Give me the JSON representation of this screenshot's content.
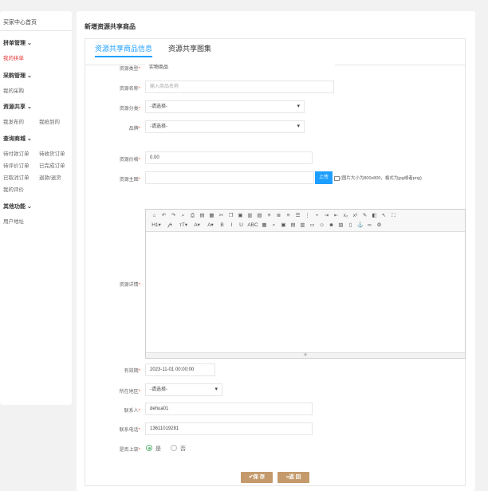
{
  "sidebar": {
    "title": "买家中心首页",
    "groups": [
      {
        "label": "拼单管理",
        "chev": "⌄",
        "items": [
          {
            "label": "我的拼单",
            "active": true
          }
        ]
      },
      {
        "label": "采购管理",
        "chev": "⌄",
        "items": [
          {
            "label": "我的采购"
          }
        ]
      },
      {
        "label": "资源共享",
        "chev": "⌄",
        "items": [
          {
            "label": "我发布的"
          },
          {
            "label": "我抢到的"
          }
        ]
      },
      {
        "label": "查询商城",
        "chev": "⌄",
        "items": [
          {
            "label": "待付款订单"
          },
          {
            "label": "待收货订单"
          },
          {
            "label": "待评价订单"
          },
          {
            "label": "已完成订单"
          },
          {
            "label": "已取消订单"
          },
          {
            "label": "退款/退货"
          },
          {
            "label": "我的评价"
          }
        ]
      },
      {
        "label": "其他功能",
        "chev": "⌄",
        "items": [
          {
            "label": "用户地址"
          }
        ]
      }
    ]
  },
  "main": {
    "title": "新增资源共享商品",
    "tabs": [
      "资源共享商品信息",
      "资源共享图集"
    ]
  },
  "form": {
    "type_label": "资源类型",
    "type_value": "实物商品",
    "name_label": "资源名称",
    "name_placeholder": "输入商品名称",
    "category_label": "资源分类",
    "category_value": "-请选择-",
    "brand_label": "品牌",
    "brand_value": "-请选择-",
    "price_label": "资源价格",
    "price_value": "0.00",
    "image_label": "资源主图",
    "upload_label": "上传",
    "image_hint": "(图片大小为800x800，格式为jpg或者png)",
    "detail_label": "资源详情",
    "expire_label": "有效期",
    "expire_value": "2023-11-01 00:00:00",
    "region_label": "所在地区",
    "region_value": "-请选择-",
    "contact_label": "联系人",
    "contact_value": "dehua01",
    "phone_label": "联系电话",
    "phone_value": "13611019281",
    "listed_label": "是否上架",
    "yes_label": "是",
    "no_label": "否",
    "save_label": "✔保 存",
    "back_label": "«返 回"
  },
  "editor": {
    "row1_icons": [
      "source-icon",
      "undo-icon",
      "redo-icon",
      "preview-icon",
      "print-icon",
      "template-icon",
      "code-icon",
      "cut-icon",
      "copy-icon",
      "paste-icon",
      "paste-text-icon",
      "paste-word-icon",
      "align-left-icon",
      "align-center-icon",
      "align-right-icon",
      "align-justify-icon",
      "ordered-list-icon",
      "unordered-list-icon",
      "indent-icon",
      "outdent-icon",
      "subscript-icon",
      "superscript-icon",
      "clear-format-icon",
      "select-all-icon",
      "cursor-icon",
      "fullscreen-icon"
    ],
    "row2": [
      "H1▾",
      "𝒻▾",
      "ᴛT▾",
      "A▾",
      "A▾",
      "B",
      "I",
      "U",
      "ABC",
      "▦",
      "⌕",
      "▣",
      "▤",
      "▥",
      "▭",
      "☺",
      "☻",
      "▨",
      "▯",
      "⚓",
      "∞",
      "⚙"
    ]
  }
}
